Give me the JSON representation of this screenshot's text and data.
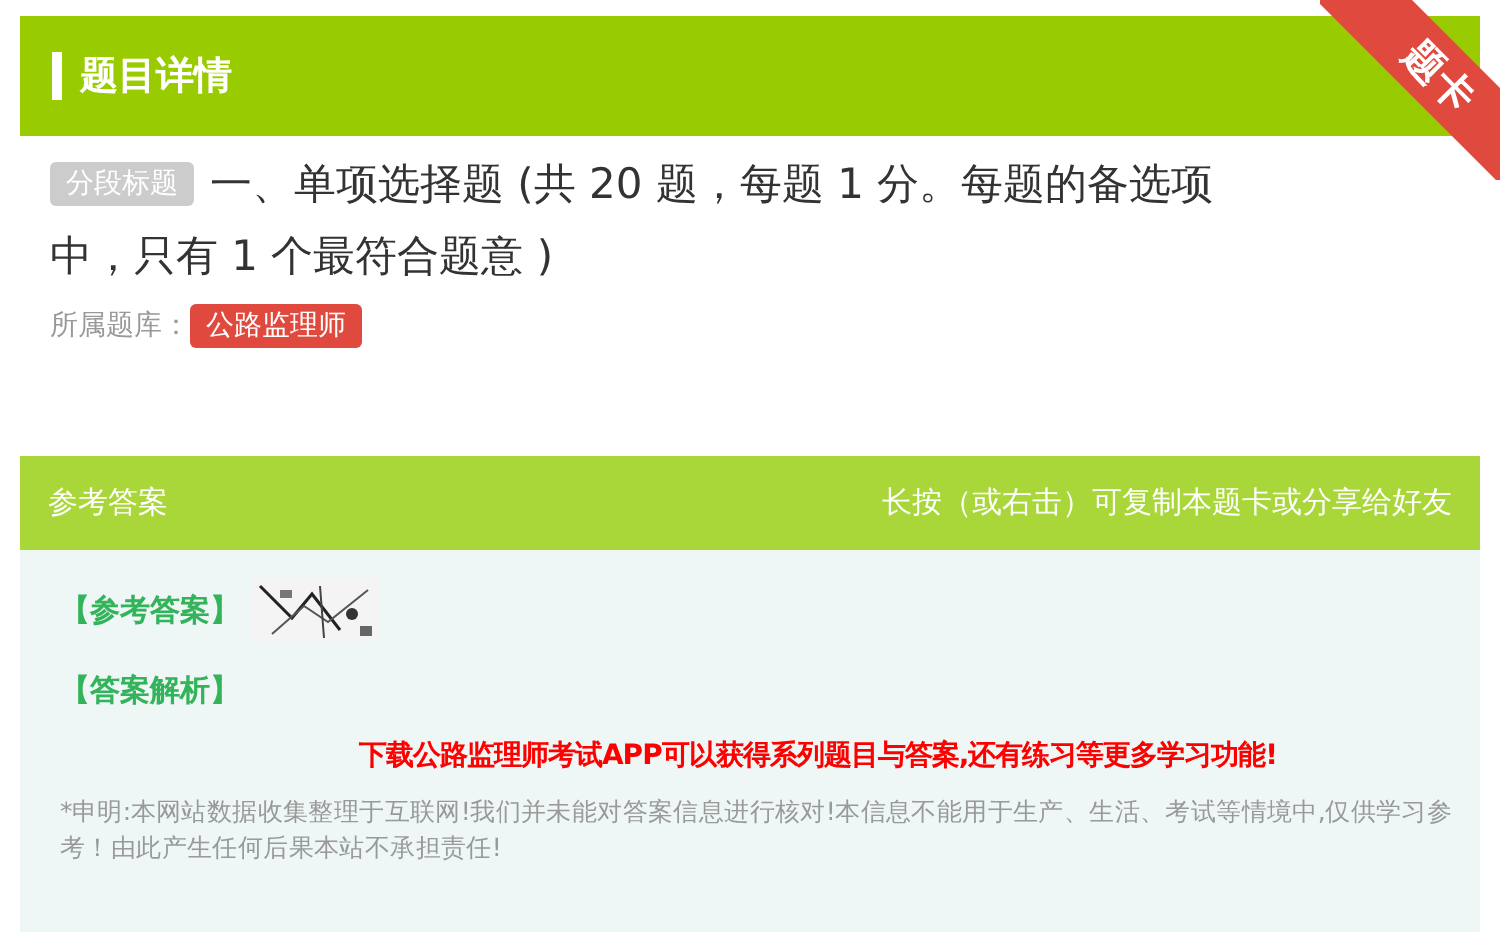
{
  "header": {
    "title": "题目详情",
    "ribbon": "题卡"
  },
  "question": {
    "tag": "分段标题",
    "text_lines": [
      "一、单项选择题 (共 20 题，每题 1 分。每题的备选项",
      "中，只有 1 个最符合题意 )"
    ],
    "bank_label": "所属题库：",
    "bank": "公路监理师"
  },
  "answer": {
    "title": "参考答案",
    "hint": "长按（或右击）可复制本题卡或分享给好友",
    "answer_label": "【参考答案】",
    "analysis_label": "【答案解析】",
    "promo": "下载公路监理师考试APP可以获得系列题目与答案,还有练习等更多学习功能!",
    "disclaimer": "*申明:本网站数据收集整理于互联网!我们并未能对答案信息进行核对!本信息不能用于生产、生活、考试等情境中,仅供学习参考！由此产生任何后果本站不承担责任!"
  }
}
